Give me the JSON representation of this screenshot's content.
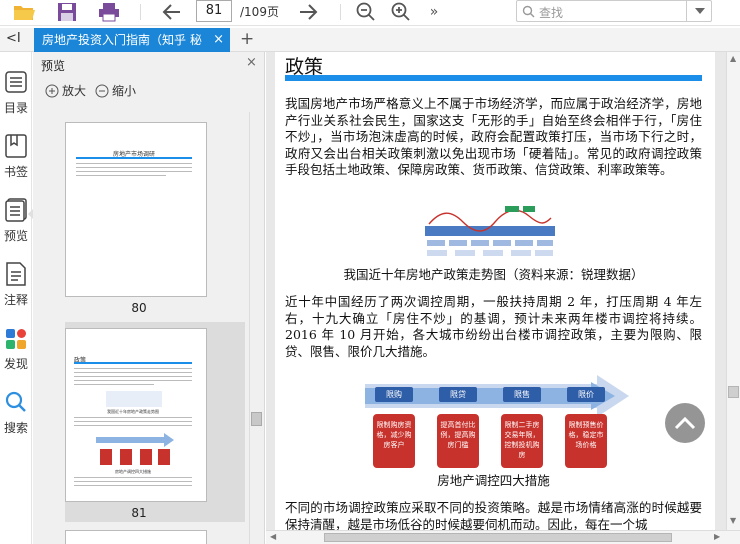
{
  "toolbar": {
    "page_current": "81",
    "page_total": "/109页",
    "search_placeholder": "查找"
  },
  "tab": {
    "title": "房地产投资入门指南（知乎 秘",
    "close": "×",
    "add": "+",
    "collapse": "<I"
  },
  "rail": {
    "items": [
      {
        "label": "目录",
        "icon": "list-icon"
      },
      {
        "label": "书签",
        "icon": "bookmark-icon"
      },
      {
        "label": "预览",
        "icon": "preview-icon"
      },
      {
        "label": "注释",
        "icon": "annotation-icon"
      },
      {
        "label": "发现",
        "icon": "discover-icon"
      },
      {
        "label": "搜索",
        "icon": "search-icon"
      }
    ]
  },
  "panel": {
    "title": "预览",
    "close": "×",
    "zoom_in": "放大",
    "zoom_out": "缩小",
    "thumbnails": [
      {
        "page": "80",
        "heading": "房地产市场调研"
      },
      {
        "page": "81",
        "heading": "政策",
        "chart_caption": "我国近十年房地产政策走势图",
        "diagram_caption": "房地产调控四大措施"
      }
    ]
  },
  "document": {
    "heading": "政策",
    "para1": "我国房地产市场严格意义上不属于市场经济学，而应属于政治经济学，房地产行业关系社会民生，国家这支「无形的手」自始至终会相伴于行，「房住不炒」，当市场泡沫虚高的时候，政府会配置政策打压，当市场下行之时，政府又会出台相关政策刺激以免出现市场「硬着陆」。常见的政府调控政策手段包括土地政策、保障房政策、货币政策、信贷政策、利率政策等。",
    "fig1_caption": "我国近十年房地产政策走势图（资料来源：锐理数据）",
    "para2": "近十年中国经历了两次调控周期，一般扶持周期 2 年，打压周期 4 年左右，十九大确立「房住不炒」的基调，预计未来两年楼市调控将持续。2016 年 10 月开始，各大城市纷纷出台楼市调控政策，主要为限购、限贷、限售、限价几大措施。",
    "fig2_caption": "房地产调控四大措施",
    "para3": "不同的市场调控政策应采取不同的投资策略。越是市场情绪高涨的时候越要保持清醒，越是市场低谷的时候越要伺机而动。因此，每在一个城",
    "measures": [
      {
        "tag": "限购",
        "text": "限制购房资格，减少购房客户"
      },
      {
        "tag": "限贷",
        "text": "提高首付比例，提高购房门槛"
      },
      {
        "tag": "限售",
        "text": "限制二手房交易年限，控制投机购房"
      },
      {
        "tag": "限价",
        "text": "限制预售价格，稳定市场价格"
      }
    ]
  },
  "colors": {
    "accent": "#1b86d8",
    "rule": "#1a8ee8",
    "measure_red": "#c8322c",
    "arrow_blue": "#8db3e2"
  }
}
